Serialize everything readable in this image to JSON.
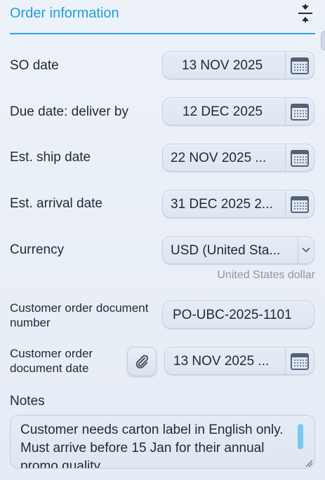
{
  "header": {
    "title": "Order information",
    "collapse_icon": "collapse-icon"
  },
  "fields": {
    "so_date": {
      "label": "SO date",
      "value": "13 NOV 2025"
    },
    "due_date": {
      "label": "Due date: deliver by",
      "value": "12 DEC 2025"
    },
    "est_ship": {
      "label": "Est. ship date",
      "value": "22 NOV 2025 ..."
    },
    "est_arrival": {
      "label": "Est. arrival date",
      "value": "31 DEC 2025 2..."
    },
    "currency": {
      "label": "Currency",
      "value": "USD (United Sta...",
      "helper": "United States dollar"
    },
    "cust_doc_number": {
      "label_line1": "Customer order document",
      "label_line2": "number",
      "value": "PO-UBC-2025-1101"
    },
    "cust_doc_date": {
      "label_line1": "Customer order",
      "label_line2": "document date",
      "value": "13 NOV 2025 ..."
    },
    "notes": {
      "label": "Notes",
      "value": "Customer needs carton label in English only. Must arrive before 15 Jan for their annual promo quality..."
    }
  },
  "colors": {
    "accent": "#1c9fe0",
    "underline": "#2fa6de",
    "scroll_thumb": "#79c9f2"
  }
}
